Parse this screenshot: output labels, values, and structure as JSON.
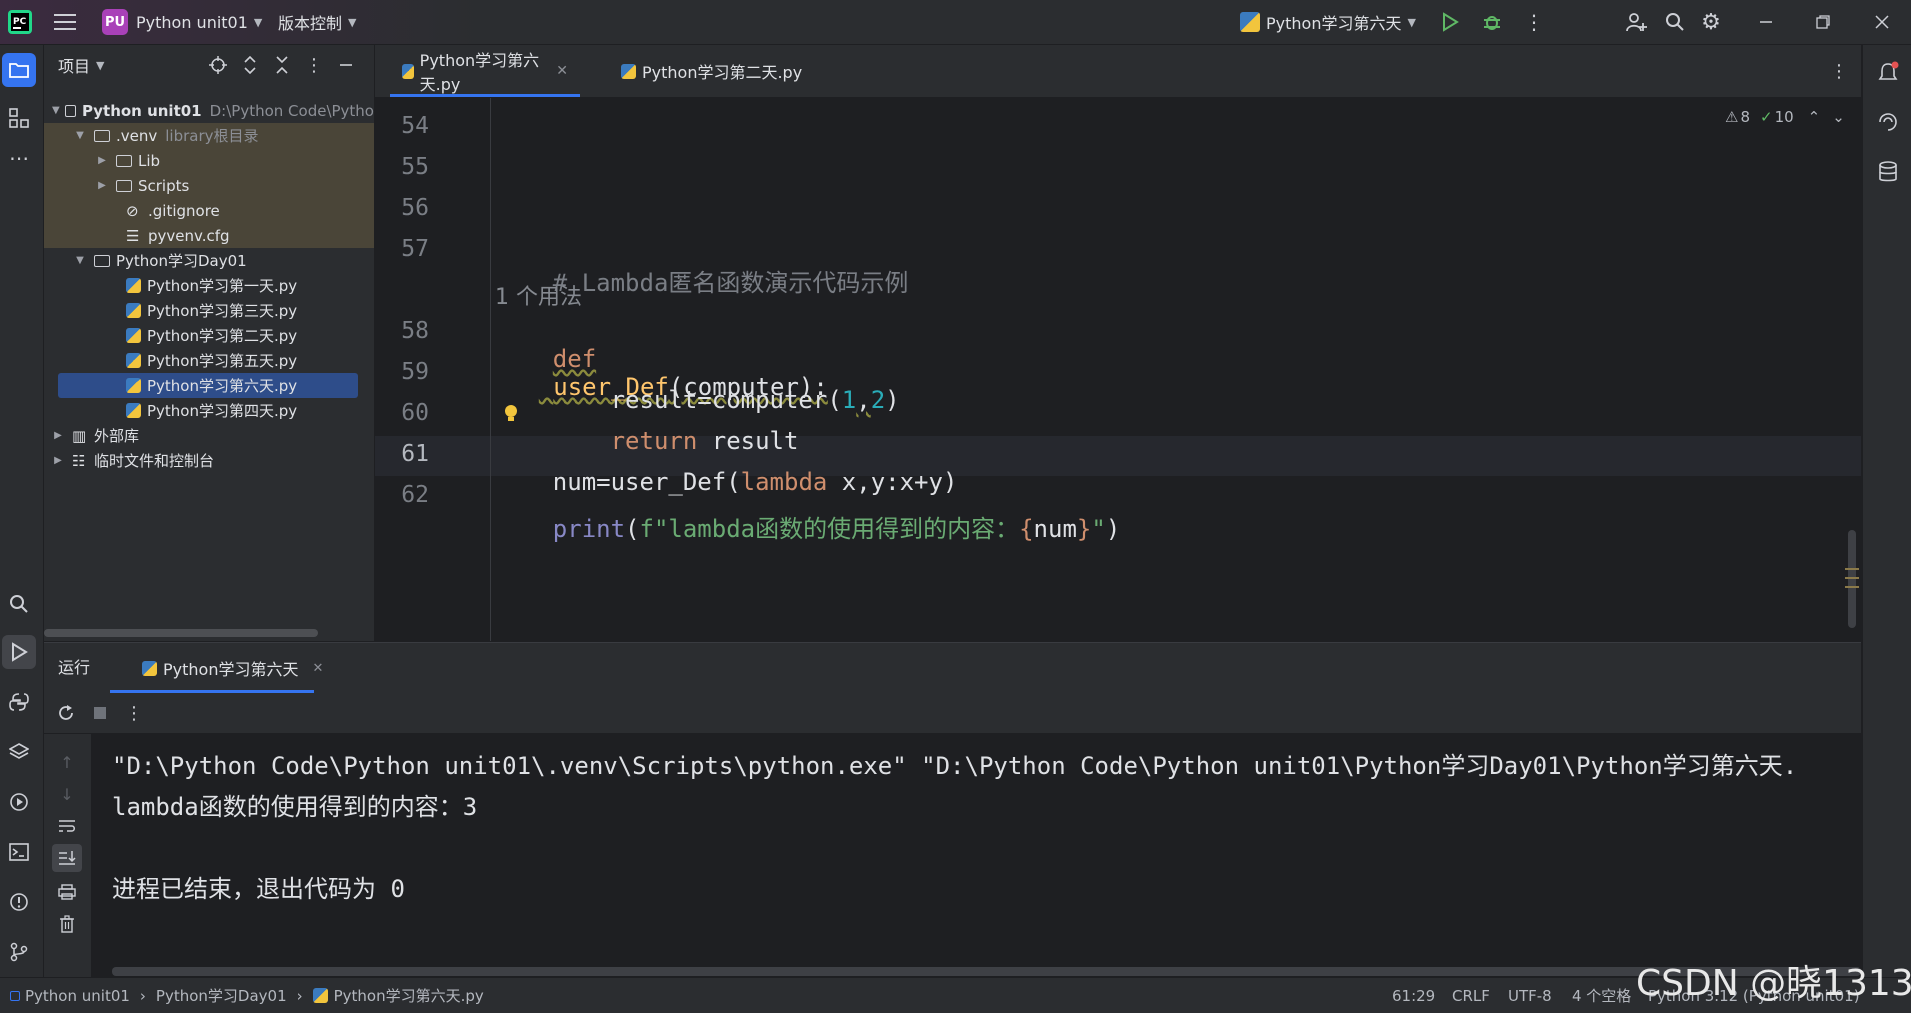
{
  "titlebar": {
    "project_badge": "PU",
    "project_name": "Python unit01",
    "vcs": "版本控制",
    "run_config": "Python学习第六天"
  },
  "project_panel": {
    "title": "项目",
    "root": {
      "name": "Python unit01",
      "path": "D:\\Python Code\\Pytho"
    },
    "venv": {
      "name": ".venv",
      "hint": "library根目录"
    },
    "lib": "Lib",
    "scripts": "Scripts",
    "gitignore": ".gitignore",
    "pyvenv": "pyvenv.cfg",
    "day_folder": "Python学习Day01",
    "files": [
      "Python学习第一天.py",
      "Python学习第三天.py",
      "Python学习第二天.py",
      "Python学习第五天.py",
      "Python学习第六天.py",
      "Python学习第四天.py"
    ],
    "external_libs": "外部库",
    "scratches": "临时文件和控制台"
  },
  "editor": {
    "tabs": [
      "Python学习第六天.py",
      "Python学习第二天.py"
    ],
    "warnings": "8",
    "checks": "10",
    "line_numbers": [
      "54",
      "55",
      "56",
      "57",
      "58",
      "59",
      "60",
      "61",
      "62"
    ],
    "usage_hint": "1 个用法",
    "code": {
      "l57_comment": "# Lambda匿名函数演示代码示例",
      "l58_def": "def",
      "l58_name": "user_Def",
      "l58_rest": "(computer):",
      "l59_a": "    result=computer(",
      "l59_n1": "1",
      "l59_comma": ",",
      "l59_n2": "2",
      "l59_close": ")",
      "l60_kw": "    return",
      "l60_rest": " result",
      "l61_a": "num=user_Def(",
      "l61_kw": "lambda",
      "l61_rest": " x,y:x+y)",
      "l62_print": "print",
      "l62_open": "(",
      "l62_str": "f\"lambda函数的使用得到的内容：",
      "l62_brace_open": "{",
      "l62_var": "num",
      "l62_brace_close": "}",
      "l62_end": "\"",
      "l62_close": ")"
    }
  },
  "run_panel": {
    "title": "运行",
    "tab": "Python学习第六天",
    "output": [
      "\"D:\\Python Code\\Python unit01\\.venv\\Scripts\\python.exe\" \"D:\\Python Code\\Python unit01\\Python学习Day01\\Python学习第六天.",
      "lambda函数的使用得到的内容：3",
      "",
      "进程已结束，退出代码为 0"
    ]
  },
  "statusbar": {
    "crumbs": [
      "Python unit01",
      "Python学习Day01",
      "Python学习第六天.py"
    ],
    "position": "61:29",
    "line_sep": "CRLF",
    "encoding": "UTF-8",
    "indent": "4 个空格",
    "interpreter": "Python 3.12 (Python unit01)"
  },
  "watermark": "CSDN @晓1313",
  "colors": {
    "accent": "#3574f0",
    "badge": "#a941b8",
    "run": "#5fb865"
  }
}
